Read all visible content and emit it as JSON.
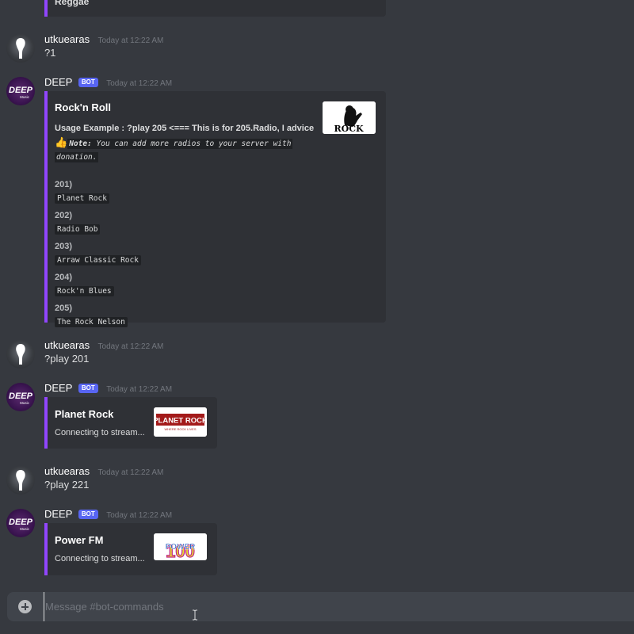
{
  "top_embed": {
    "text": "Reggae"
  },
  "messages": [
    {
      "username": "utkuearas",
      "timestamp": "Today at 12:22 AM",
      "content": "?1"
    },
    {
      "username": "DEEP",
      "bot_tag": "BOT",
      "timestamp": "Today at 12:22 AM",
      "embed": {
        "title": "Rock'n Roll",
        "usage": "Usage Example : ?play 205 <=== This is for 205.Radio, I advice",
        "note_prefix": "Note:",
        "note_line1": " You can add more radios to your server with",
        "note_line2": "donation.",
        "thumb_text": "ROCK",
        "fields": [
          {
            "name": "201)",
            "value": "Planet Rock"
          },
          {
            "name": "202)",
            "value": "Radio Bob"
          },
          {
            "name": "203)",
            "value": "Arraw Classic Rock"
          },
          {
            "name": "204)",
            "value": "Rock'n Blues"
          },
          {
            "name": "205)",
            "value": "The Rock Nelson"
          }
        ]
      }
    },
    {
      "username": "utkuearas",
      "timestamp": "Today at 12:22 AM",
      "content": "?play 201"
    },
    {
      "username": "DEEP",
      "bot_tag": "BOT",
      "timestamp": "Today at 12:22 AM",
      "embed": {
        "title": "Planet Rock",
        "description": "Connecting to stream...",
        "thumb_text": "PLANET ROCK",
        "thumb_sub": "WHERE ROCK LIVES"
      }
    },
    {
      "username": "utkuearas",
      "timestamp": "Today at 12:22 AM",
      "content": "?play 221"
    },
    {
      "username": "DEEP",
      "bot_tag": "BOT",
      "timestamp": "Today at 12:22 AM",
      "embed": {
        "title": "Power FM",
        "description": "Connecting to stream...",
        "thumb_text": "POWER",
        "thumb_num": "100"
      }
    }
  ],
  "bot_avatar_text": "DEEP",
  "bot_avatar_sub": "Music",
  "input": {
    "placeholder": "Message #bot-commands"
  },
  "colors": {
    "background": "#36393f",
    "embed_bg": "#2f3136",
    "accent": "#9146ff",
    "bot_tag": "#5865f2",
    "input_bg": "#40444b"
  }
}
